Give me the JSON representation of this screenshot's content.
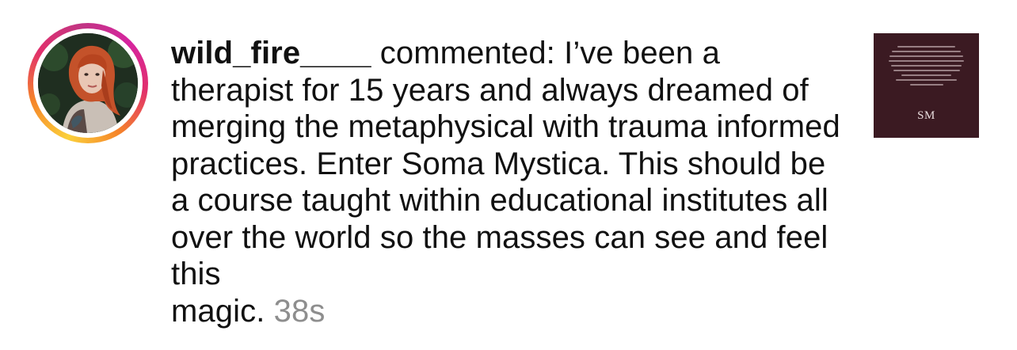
{
  "notification": {
    "username": "wild_fire____",
    "action": "commented:",
    "comment_text": "I’ve been a therapist for 15 years and always dreamed of merging the metaphysical with trauma informed practices. Enter Soma Mystica. This should be a course taught within educational institutes all over the world so the masses can see and feel this",
    "last_word": "magic.",
    "timestamp": "38s",
    "thumbnail": {
      "logo": "SM",
      "background_color": "#3b1a22"
    }
  },
  "colors": {
    "text": "#111111",
    "timestamp": "#8e8e8e",
    "story_ring": [
      "#fbd03b",
      "#f58529",
      "#e1306c",
      "#c13584"
    ]
  }
}
